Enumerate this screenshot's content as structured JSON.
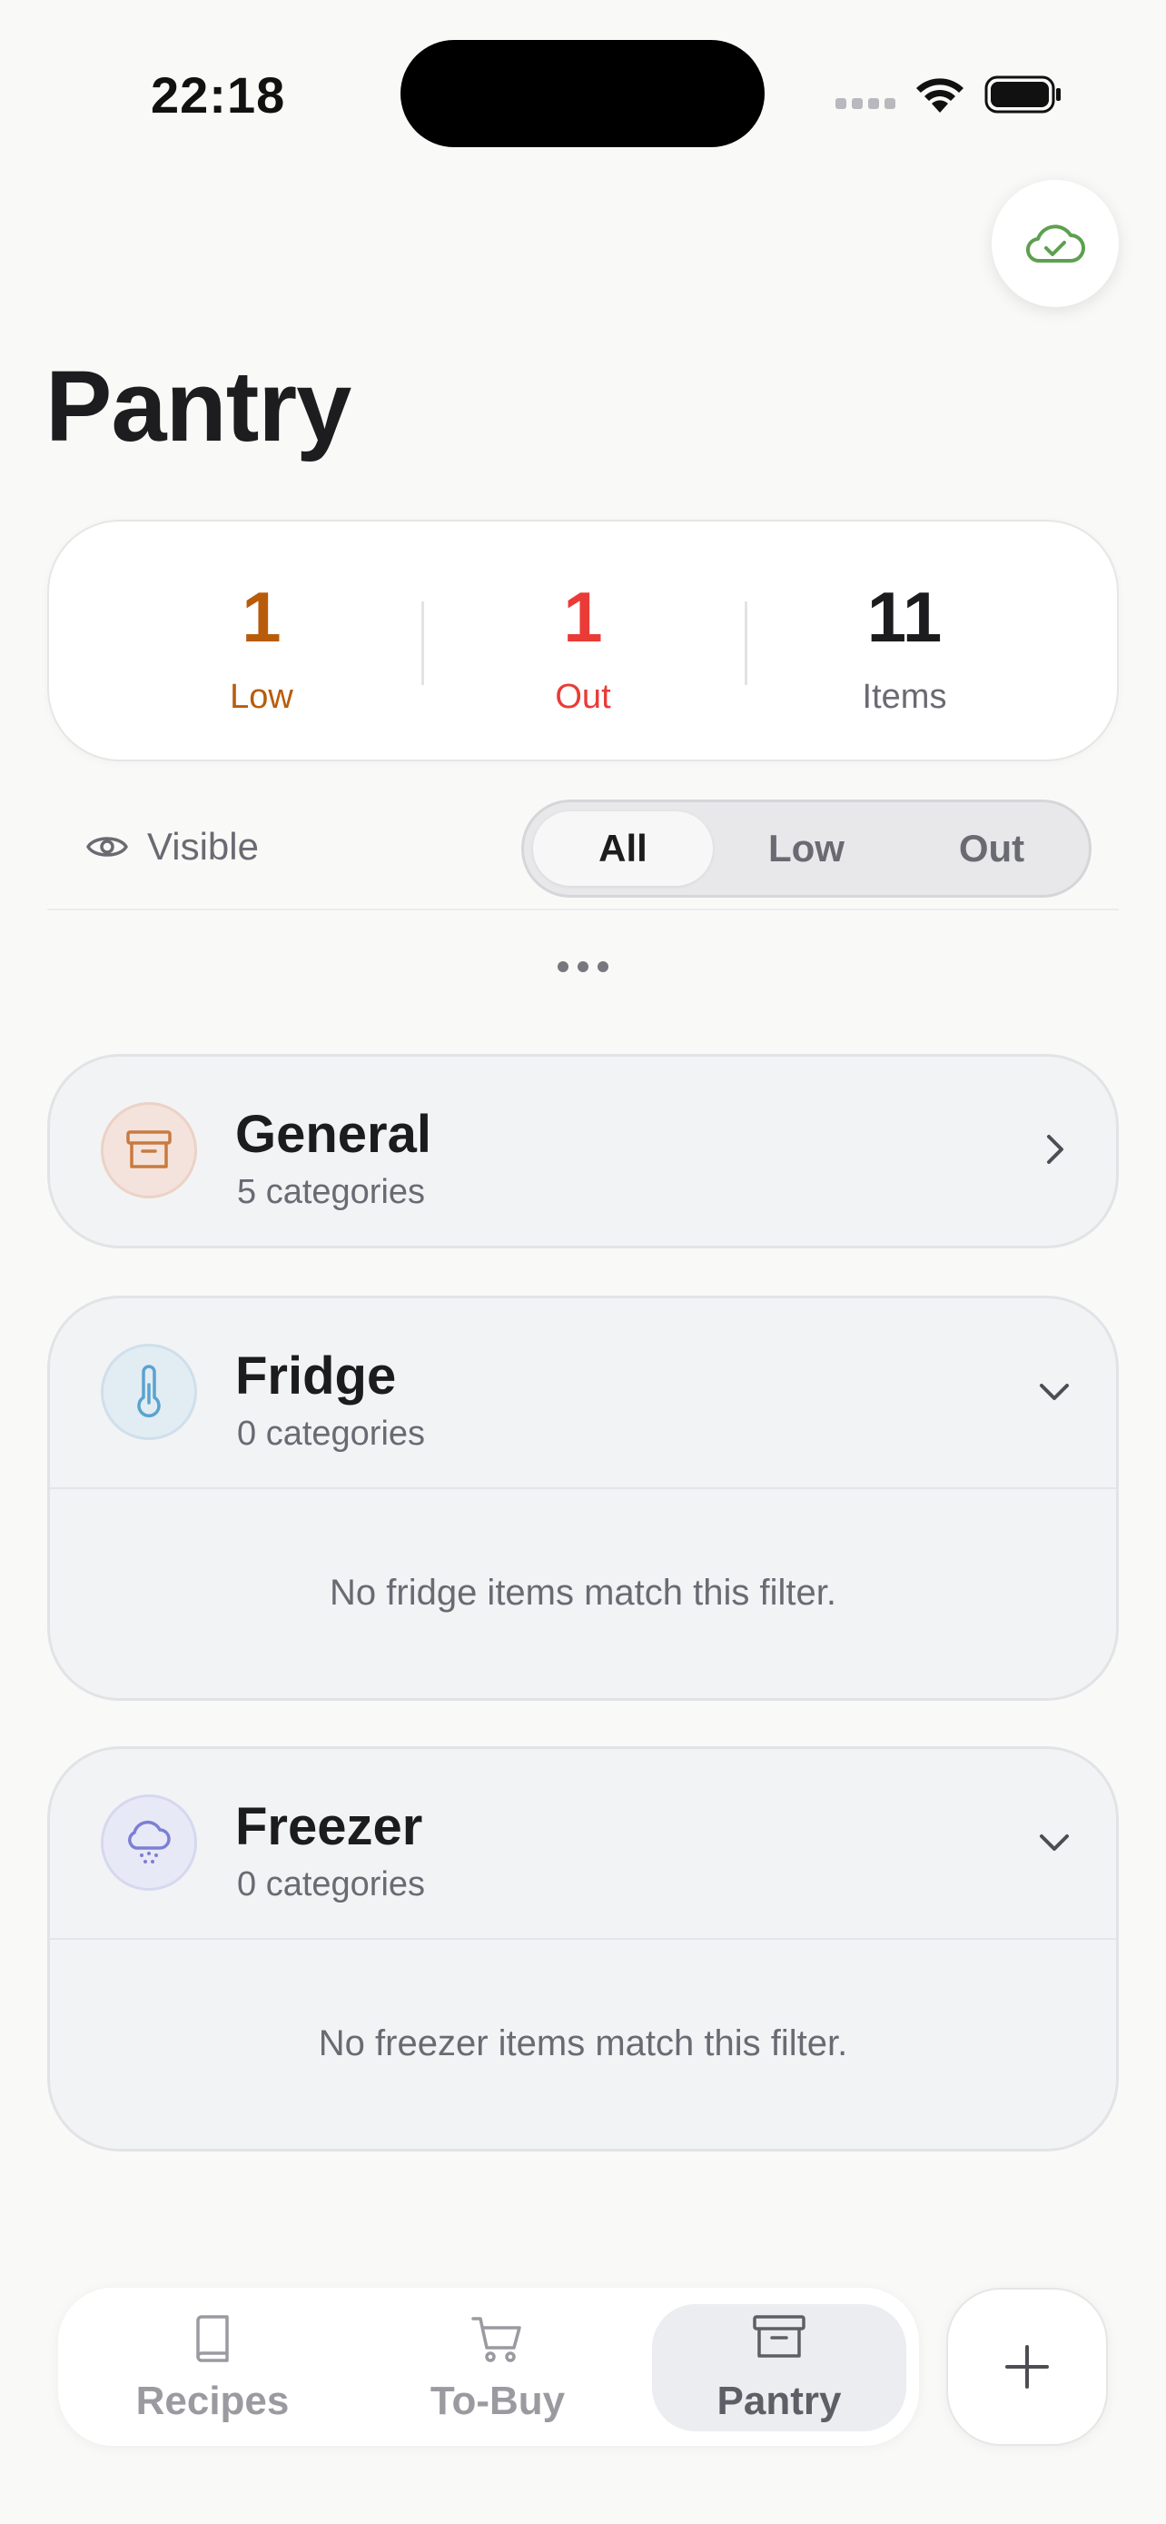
{
  "status_bar": {
    "time": "22:18"
  },
  "page": {
    "title": "Pantry"
  },
  "summary": {
    "low": {
      "value": "1",
      "label": "Low",
      "color": "#b85c0b"
    },
    "out": {
      "value": "1",
      "label": "Out",
      "color": "#ea3b36"
    },
    "items": {
      "value": "11",
      "label": "Items",
      "color": "#1c1c1e"
    }
  },
  "visibility": {
    "label": "Visible"
  },
  "filters": {
    "options": [
      "All",
      "Low",
      "Out"
    ],
    "selected": "All"
  },
  "sections": [
    {
      "name": "General",
      "count": "5 categories",
      "icon": "archive-box-icon",
      "expanded": false,
      "empty_message": ""
    },
    {
      "name": "Fridge",
      "count": "0 categories",
      "icon": "thermometer-icon",
      "expanded": true,
      "empty_message": "No fridge items match this filter."
    },
    {
      "name": "Freezer",
      "count": "0 categories",
      "icon": "snow-cloud-icon",
      "expanded": true,
      "empty_message": "No freezer items match this filter."
    }
  ],
  "tab_bar": {
    "tabs": [
      {
        "label": "Recipes",
        "icon": "book-icon"
      },
      {
        "label": "To-Buy",
        "icon": "cart-icon"
      },
      {
        "label": "Pantry",
        "icon": "archive-box-icon"
      }
    ],
    "active": "Pantry"
  },
  "colors": {
    "sync_green": "#5da04f",
    "fridge_blue": "#5aa3cf",
    "freezer_purple": "#7b7fd6",
    "general_orange": "#c97a3f"
  }
}
